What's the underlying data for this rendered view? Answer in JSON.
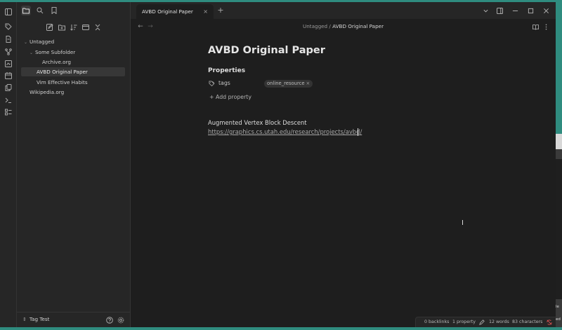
{
  "tab": {
    "title": "AVBD Original Paper",
    "close": "×",
    "new": "+"
  },
  "breadcrumb": {
    "folder": "Untagged",
    "separator": "/",
    "current": "AVBD Original Paper"
  },
  "tree": {
    "root_folder": "Untagged",
    "subfolder": "Some Subfolder",
    "items": [
      "Archive.org",
      "AVBD Original Paper",
      "Vim Effective Habits",
      "Wikipedia.org"
    ]
  },
  "vault": {
    "name": "Tag Test"
  },
  "note": {
    "title": "AVBD Original Paper",
    "properties_heading": "Properties",
    "property_key": "tags",
    "tag_value": "online_resource",
    "tag_remove": "×",
    "add_property": "+ Add property",
    "line1": "Augmented Vertex Block Descent",
    "link": "https://graphics.cs.utah.edu/research/projects/avbd/"
  },
  "statusbar": {
    "backlinks": "0 backlinks",
    "properties": "1 property",
    "words": "12 words",
    "characters": "83 characters"
  },
  "background_window": {
    "fragment_1": "le",
    "fragment_2": "ed"
  },
  "colors": {
    "accent_bg": "#2f8c7f",
    "editor_bg": "#1e1e1e",
    "sidebar_bg": "#262626",
    "sync_error": "#e05353"
  }
}
